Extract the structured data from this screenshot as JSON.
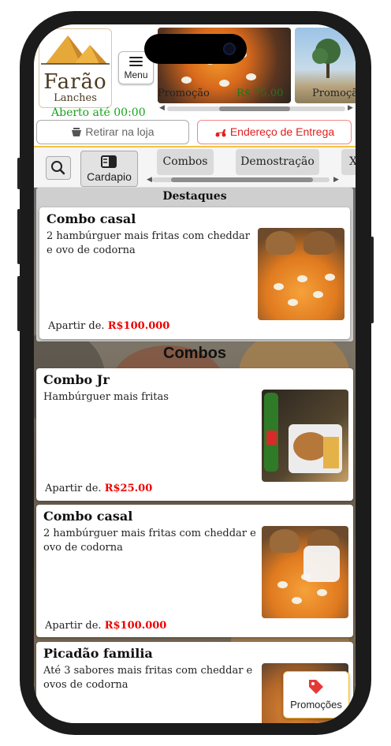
{
  "header": {
    "logo_name": "Farão",
    "logo_sub": "Lanches",
    "open_status": "Aberto até 00:00",
    "menu_label": "Menu",
    "promo_cards": [
      {
        "label": "Promoção",
        "price": "R$ 75.00"
      },
      {
        "label": "Promoção",
        "price": ""
      }
    ],
    "pickup_label": "Retirar na loja",
    "delivery_label": "Endereço de Entrega"
  },
  "categories": {
    "cardapio_label": "Cardapio",
    "items": [
      "Combos",
      "Demostração",
      "X"
    ]
  },
  "featured": {
    "title": "Destaques",
    "item": {
      "name": "Combo casal",
      "description": "2 hambúrguer mais fritas com cheddar e ovo de codorna",
      "price_prefix": "Apartir de.",
      "price": "R$100.000"
    }
  },
  "section": {
    "title": "Combos",
    "items": [
      {
        "name": "Combo Jr",
        "description": "Hambúrguer mais fritas",
        "price_prefix": "Apartir de.",
        "price": "R$25.00"
      },
      {
        "name": "Combo casal",
        "description": "2 hambúrguer mais fritas com cheddar e ovo de codorna",
        "price_prefix": "Apartir de.",
        "price": "R$100.000"
      },
      {
        "name": "Picadão familia",
        "description": "Até 3 sabores mais fritas com cheddar e ovos de codorna",
        "price_prefix": "",
        "price": ""
      }
    ]
  },
  "fab": {
    "label": "Promoções"
  },
  "colors": {
    "accent_gold": "#f2c53d",
    "price_red": "#e00000",
    "open_green": "#16a51a",
    "delivery_red": "#e31e1e"
  }
}
